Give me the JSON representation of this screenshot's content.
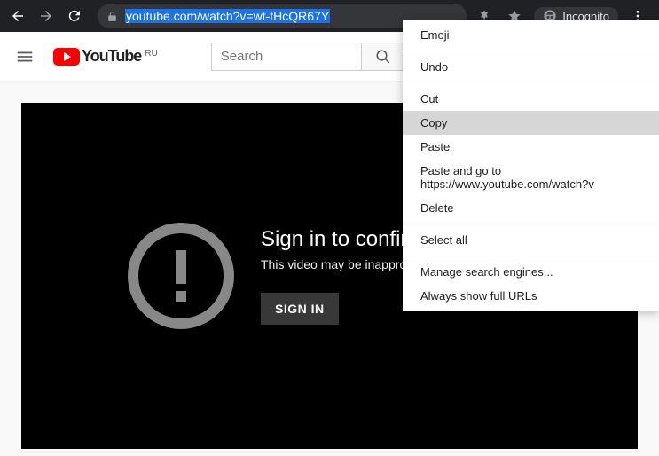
{
  "browser": {
    "url": "youtube.com/watch?v=wt-tHcQR67Y",
    "incognito_label": "Incognito"
  },
  "yt": {
    "logo_text": "YouTube",
    "logo_region": "RU",
    "search_placeholder": "Search"
  },
  "video": {
    "title": "Sign in to confirm your age",
    "subtitle": "This video may be inappropriate for some users.",
    "signin_label": "SIGN IN"
  },
  "context_menu": {
    "items": [
      {
        "label": "Emoji",
        "type": "item"
      },
      {
        "type": "sep"
      },
      {
        "label": "Undo",
        "type": "item"
      },
      {
        "type": "sep"
      },
      {
        "label": "Cut",
        "type": "item"
      },
      {
        "label": "Copy",
        "type": "item",
        "highlighted": true
      },
      {
        "label": "Paste",
        "type": "item"
      },
      {
        "label": "Paste and go to https://www.youtube.com/watch?v",
        "type": "item"
      },
      {
        "label": "Delete",
        "type": "item"
      },
      {
        "type": "sep"
      },
      {
        "label": "Select all",
        "type": "item"
      },
      {
        "type": "sep"
      },
      {
        "label": "Manage search engines...",
        "type": "item"
      },
      {
        "label": "Always show full URLs",
        "type": "item"
      }
    ]
  }
}
